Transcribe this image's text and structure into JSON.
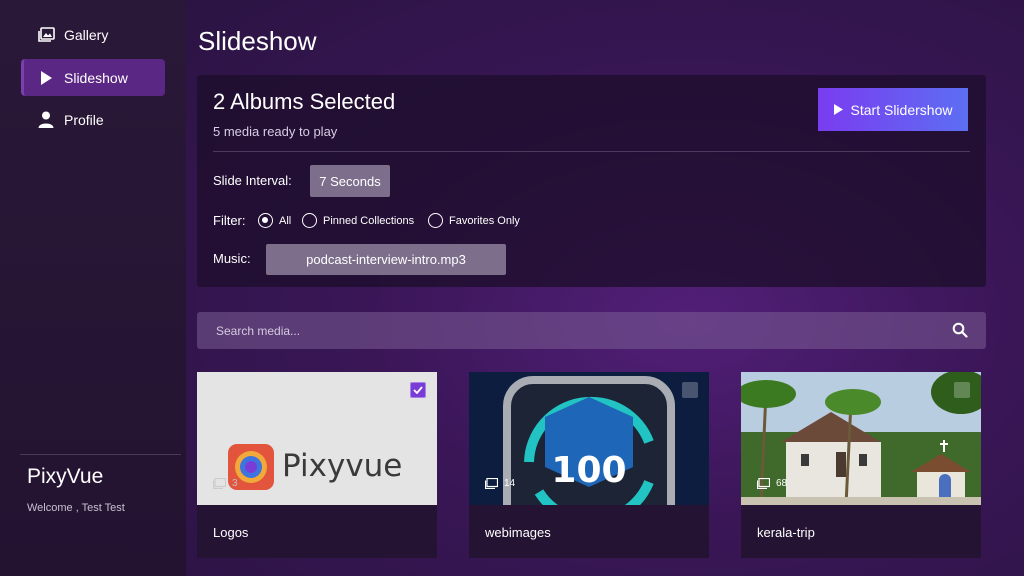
{
  "sidebar": {
    "items": [
      {
        "label": "Gallery",
        "icon": "gallery-icon"
      },
      {
        "label": "Slideshow",
        "icon": "play-icon",
        "active": true
      },
      {
        "label": "Profile",
        "icon": "user-icon"
      }
    ],
    "brand": "PixyVue",
    "welcome": "Welcome , Test Test"
  },
  "main": {
    "title": "Slideshow",
    "panel": {
      "title": "2 Albums Selected",
      "subtitle": "5 media ready to play",
      "start_label": "Start Slidershow",
      "interval_label": "Slide Interval:",
      "interval_value": "7 Seconds",
      "filter_label": "Filter:",
      "filters": [
        {
          "label": "All",
          "checked": true
        },
        {
          "label": "Pinned Collections",
          "checked": false
        },
        {
          "label": "Favorites Only",
          "checked": false
        }
      ],
      "music_label": "Music:",
      "music_value": "podcast-interview-intro.mp3"
    },
    "search": {
      "placeholder": "Search media..."
    },
    "albums": [
      {
        "name": "Logos",
        "count": "3",
        "selected": true,
        "thumb_text": "Pixyvue"
      },
      {
        "name": "webimages",
        "count": "14",
        "selected": false,
        "thumb_text": "100"
      },
      {
        "name": "kerala-trip",
        "count": "68",
        "selected": false
      }
    ]
  },
  "colors": {
    "accent": "#7a3cf0",
    "active_nav": "#5a2784",
    "button_gradient_end": "#5d6ef2",
    "input_bg": "#7d6f8c"
  }
}
